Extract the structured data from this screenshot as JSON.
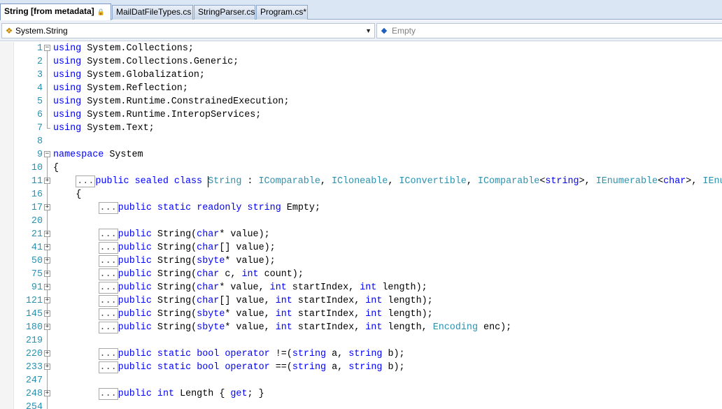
{
  "tabs": [
    {
      "label": "String [from metadata]",
      "locked": true,
      "active": true
    },
    {
      "label": "MailDatFileTypes.cs",
      "active": false
    },
    {
      "label": "StringParser.cs",
      "active": false
    },
    {
      "label": "Program.cs*",
      "active": false
    }
  ],
  "nav": {
    "type_combo": "System.String",
    "member_combo": "Empty"
  },
  "icons": {
    "lock": "lock-icon",
    "type": "class-icon",
    "member": "field-icon",
    "dropdown": "chevron-down-icon",
    "collapse": "collapse-icon",
    "expand": "expand-icon"
  },
  "colors": {
    "keyword": "#0000ff",
    "type": "#2b91af",
    "line_number": "#2b91af",
    "tab_strip": "#dbe6f4"
  },
  "code_lines": [
    {
      "n": "1",
      "fold": "minus",
      "parts": [
        [
          "kw",
          "using"
        ],
        [
          "",
          " System.Collections;"
        ]
      ]
    },
    {
      "n": "2",
      "parts": [
        [
          "kw",
          "using"
        ],
        [
          "",
          " System.Collections.Generic;"
        ]
      ]
    },
    {
      "n": "3",
      "parts": [
        [
          "kw",
          "using"
        ],
        [
          "",
          " System.Globalization;"
        ]
      ]
    },
    {
      "n": "4",
      "parts": [
        [
          "kw",
          "using"
        ],
        [
          "",
          " System.Reflection;"
        ]
      ]
    },
    {
      "n": "5",
      "parts": [
        [
          "kw",
          "using"
        ],
        [
          "",
          " System.Runtime.ConstrainedExecution;"
        ]
      ]
    },
    {
      "n": "6",
      "parts": [
        [
          "kw",
          "using"
        ],
        [
          "",
          " System.Runtime.InteropServices;"
        ]
      ]
    },
    {
      "n": "7",
      "fold": "end",
      "parts": [
        [
          "kw",
          "using"
        ],
        [
          "",
          " System.Text;"
        ]
      ]
    },
    {
      "n": "8",
      "parts": []
    },
    {
      "n": "9",
      "fold": "minus",
      "parts": [
        [
          "kw",
          "namespace"
        ],
        [
          "",
          " System"
        ]
      ]
    },
    {
      "n": "10",
      "parts": [
        [
          "",
          "{"
        ]
      ]
    },
    {
      "n": "11",
      "fold": "plus",
      "indent": 2,
      "collapsed": true,
      "parts": [
        [
          "kw",
          "public"
        ],
        [
          "",
          " "
        ],
        [
          "kw",
          "sealed"
        ],
        [
          "",
          " "
        ],
        [
          "kw",
          "class"
        ],
        [
          "",
          " "
        ],
        [
          "caret",
          ""
        ],
        [
          "ty",
          "String"
        ],
        [
          "",
          " : "
        ],
        [
          "ty",
          "IComparable"
        ],
        [
          "",
          ", "
        ],
        [
          "ty",
          "ICloneable"
        ],
        [
          "",
          ", "
        ],
        [
          "ty",
          "IConvertible"
        ],
        [
          "",
          ", "
        ],
        [
          "ty",
          "IComparable"
        ],
        [
          "",
          "<"
        ],
        [
          "kw",
          "string"
        ],
        [
          "",
          ">, "
        ],
        [
          "ty",
          "IEnumerable"
        ],
        [
          "",
          "<"
        ],
        [
          "kw",
          "char"
        ],
        [
          "",
          ">, "
        ],
        [
          "ty",
          "IEnum"
        ]
      ]
    },
    {
      "n": "16",
      "indent": 2,
      "parts": [
        [
          "",
          "{"
        ]
      ]
    },
    {
      "n": "17",
      "fold": "plus",
      "indent": 4,
      "collapsed": true,
      "parts": [
        [
          "kw",
          "public"
        ],
        [
          "",
          " "
        ],
        [
          "kw",
          "static"
        ],
        [
          "",
          " "
        ],
        [
          "kw",
          "readonly"
        ],
        [
          "",
          " "
        ],
        [
          "kw",
          "string"
        ],
        [
          "",
          " Empty;"
        ]
      ]
    },
    {
      "n": "20",
      "parts": []
    },
    {
      "n": "21",
      "fold": "plus",
      "indent": 4,
      "collapsed": true,
      "parts": [
        [
          "kw",
          "public"
        ],
        [
          "",
          " String("
        ],
        [
          "kw",
          "char"
        ],
        [
          "",
          "* value);"
        ]
      ]
    },
    {
      "n": "41",
      "fold": "plus",
      "indent": 4,
      "collapsed": true,
      "parts": [
        [
          "kw",
          "public"
        ],
        [
          "",
          " String("
        ],
        [
          "kw",
          "char"
        ],
        [
          "",
          "[] value);"
        ]
      ]
    },
    {
      "n": "50",
      "fold": "plus",
      "indent": 4,
      "collapsed": true,
      "parts": [
        [
          "kw",
          "public"
        ],
        [
          "",
          " String("
        ],
        [
          "kw",
          "sbyte"
        ],
        [
          "",
          "* value);"
        ]
      ]
    },
    {
      "n": "75",
      "fold": "plus",
      "indent": 4,
      "collapsed": true,
      "parts": [
        [
          "kw",
          "public"
        ],
        [
          "",
          " String("
        ],
        [
          "kw",
          "char"
        ],
        [
          "",
          " c, "
        ],
        [
          "kw",
          "int"
        ],
        [
          "",
          " count);"
        ]
      ]
    },
    {
      "n": "91",
      "fold": "plus",
      "indent": 4,
      "collapsed": true,
      "parts": [
        [
          "kw",
          "public"
        ],
        [
          "",
          " String("
        ],
        [
          "kw",
          "char"
        ],
        [
          "",
          "* value, "
        ],
        [
          "kw",
          "int"
        ],
        [
          "",
          " startIndex, "
        ],
        [
          "kw",
          "int"
        ],
        [
          "",
          " length);"
        ]
      ]
    },
    {
      "n": "121",
      "fold": "plus",
      "indent": 4,
      "collapsed": true,
      "parts": [
        [
          "kw",
          "public"
        ],
        [
          "",
          " String("
        ],
        [
          "kw",
          "char"
        ],
        [
          "",
          "[] value, "
        ],
        [
          "kw",
          "int"
        ],
        [
          "",
          " startIndex, "
        ],
        [
          "kw",
          "int"
        ],
        [
          "",
          " length);"
        ]
      ]
    },
    {
      "n": "145",
      "fold": "plus",
      "indent": 4,
      "collapsed": true,
      "parts": [
        [
          "kw",
          "public"
        ],
        [
          "",
          " String("
        ],
        [
          "kw",
          "sbyte"
        ],
        [
          "",
          "* value, "
        ],
        [
          "kw",
          "int"
        ],
        [
          "",
          " startIndex, "
        ],
        [
          "kw",
          "int"
        ],
        [
          "",
          " length);"
        ]
      ]
    },
    {
      "n": "180",
      "fold": "plus",
      "indent": 4,
      "collapsed": true,
      "parts": [
        [
          "kw",
          "public"
        ],
        [
          "",
          " String("
        ],
        [
          "kw",
          "sbyte"
        ],
        [
          "",
          "* value, "
        ],
        [
          "kw",
          "int"
        ],
        [
          "",
          " startIndex, "
        ],
        [
          "kw",
          "int"
        ],
        [
          "",
          " length, "
        ],
        [
          "ty",
          "Encoding"
        ],
        [
          "",
          " enc);"
        ]
      ]
    },
    {
      "n": "219",
      "parts": []
    },
    {
      "n": "220",
      "fold": "plus",
      "indent": 4,
      "collapsed": true,
      "parts": [
        [
          "kw",
          "public"
        ],
        [
          "",
          " "
        ],
        [
          "kw",
          "static"
        ],
        [
          "",
          " "
        ],
        [
          "kw",
          "bool"
        ],
        [
          "",
          " "
        ],
        [
          "kw",
          "operator"
        ],
        [
          "",
          " !=("
        ],
        [
          "kw",
          "string"
        ],
        [
          "",
          " a, "
        ],
        [
          "kw",
          "string"
        ],
        [
          "",
          " b);"
        ]
      ]
    },
    {
      "n": "233",
      "fold": "plus",
      "indent": 4,
      "collapsed": true,
      "parts": [
        [
          "kw",
          "public"
        ],
        [
          "",
          " "
        ],
        [
          "kw",
          "static"
        ],
        [
          "",
          " "
        ],
        [
          "kw",
          "bool"
        ],
        [
          "",
          " "
        ],
        [
          "kw",
          "operator"
        ],
        [
          "",
          " ==("
        ],
        [
          "kw",
          "string"
        ],
        [
          "",
          " a, "
        ],
        [
          "kw",
          "string"
        ],
        [
          "",
          " b);"
        ]
      ]
    },
    {
      "n": "247",
      "parts": []
    },
    {
      "n": "248",
      "fold": "plus",
      "indent": 4,
      "collapsed": true,
      "parts": [
        [
          "kw",
          "public"
        ],
        [
          "",
          " "
        ],
        [
          "kw",
          "int"
        ],
        [
          "",
          " Length { "
        ],
        [
          "kw",
          "get"
        ],
        [
          "",
          "; }"
        ]
      ]
    },
    {
      "n": "254",
      "parts": []
    }
  ],
  "collapsed_marker": "..."
}
